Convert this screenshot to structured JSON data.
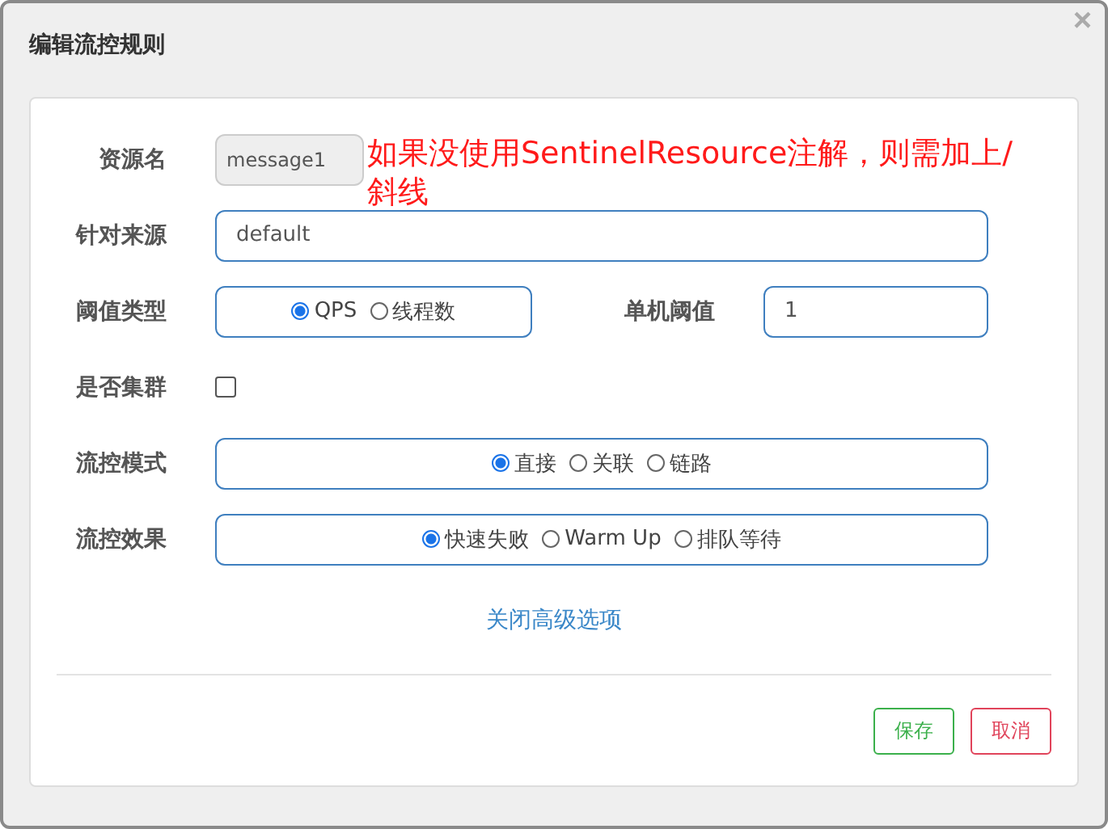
{
  "dialog": {
    "title": "编辑流控规则",
    "close": "×"
  },
  "annotation": [
    "如果没使用SentinelResource注解，则需加上/",
    "斜线"
  ],
  "rows": [
    {
      "label": "资源名",
      "kind": "text",
      "value": "message1",
      "disabled": true
    },
    {
      "label": "针对来源",
      "kind": "text",
      "value": "default",
      "disabled": false
    },
    {
      "label": "阈值类型",
      "kind": "radio",
      "options": [
        {
          "label": "QPS",
          "selected": true
        },
        {
          "label": "线程数",
          "selected": false
        }
      ],
      "extra": {
        "label": "单机阈值",
        "value": "1"
      }
    },
    {
      "label": "是否集群",
      "kind": "checkbox",
      "checked": false
    },
    {
      "label": "流控模式",
      "kind": "radio",
      "options": [
        {
          "label": "直接",
          "selected": true
        },
        {
          "label": "关联",
          "selected": false
        },
        {
          "label": "链路",
          "selected": false
        }
      ]
    },
    {
      "label": "流控效果",
      "kind": "radio",
      "options": [
        {
          "label": "快速失败",
          "selected": true
        },
        {
          "label": "Warm Up",
          "selected": false
        },
        {
          "label": "排队等待",
          "selected": false
        }
      ]
    }
  ],
  "advanced_link": "关闭高级选项",
  "buttons": [
    {
      "label": "保存",
      "kind": "save"
    },
    {
      "label": "取消",
      "kind": "cancel"
    }
  ]
}
